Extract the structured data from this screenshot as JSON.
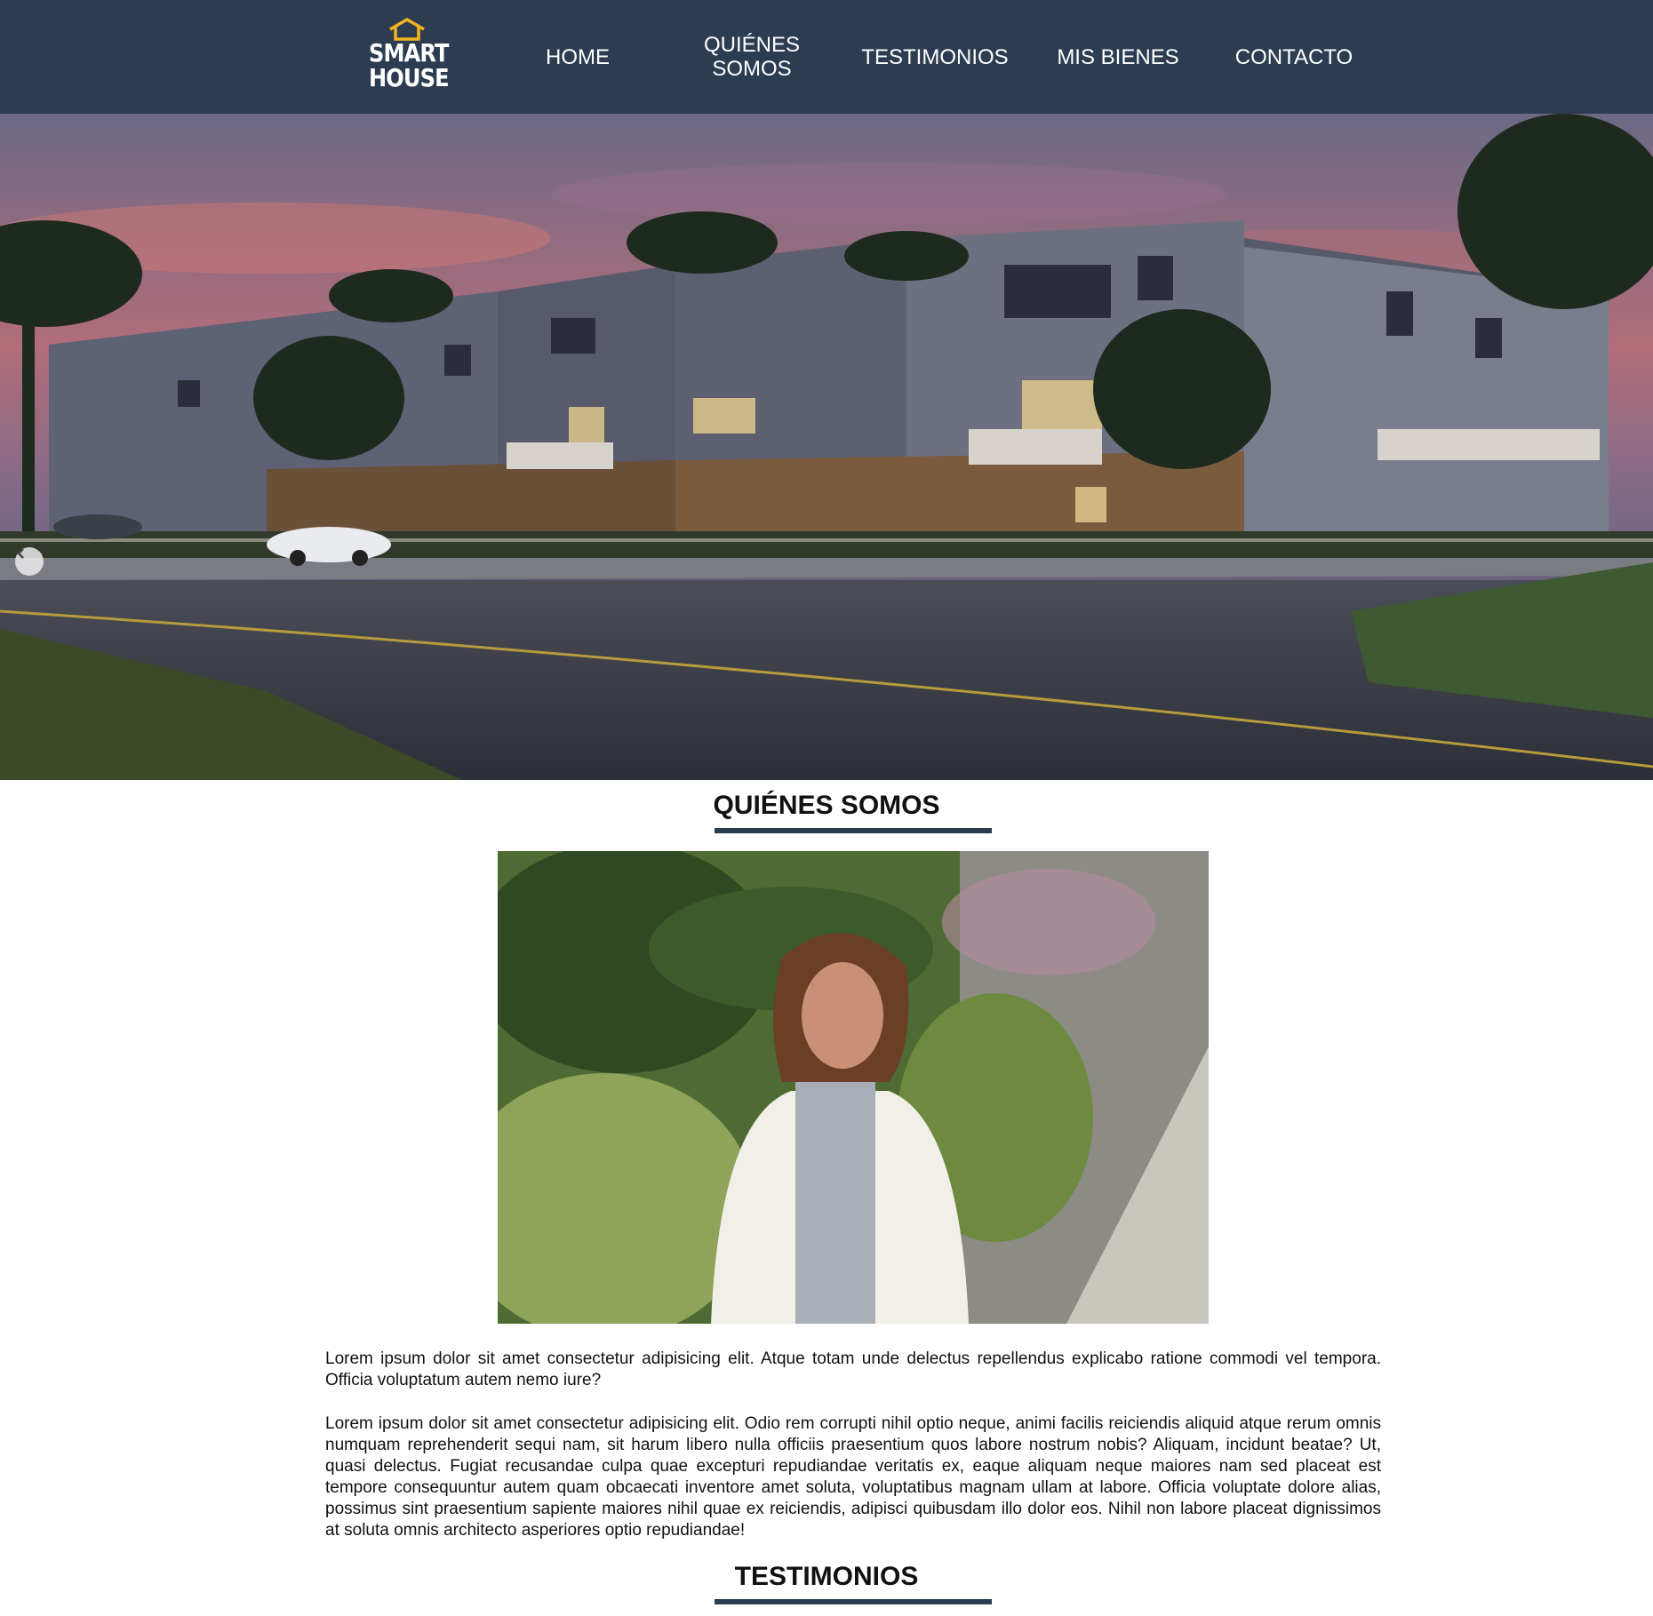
{
  "brand": {
    "line1": "SMART",
    "line2": "HOUSE",
    "accent_color": "#f2b51c"
  },
  "nav": {
    "background": "#2c3d52",
    "items": [
      {
        "label": "HOME"
      },
      {
        "label": "QUIÉNES\nSOMOS"
      },
      {
        "label": "TESTIMONIOS"
      },
      {
        "label": "MIS BIENES"
      },
      {
        "label": "CONTACTO"
      }
    ]
  },
  "hero": {
    "prev_icon": "chevron-left-icon"
  },
  "about": {
    "title": "QUIÉNES SOMOS",
    "paragraphs": [
      "Lorem ipsum dolor sit amet consectetur adipisicing elit. Atque totam unde delectus repellendus explicabo ratione commodi vel tempora. Officia voluptatum autem nemo iure?",
      "Lorem ipsum dolor sit amet consectetur adipisicing elit. Odio rem corrupti nihil optio neque, animi facilis reiciendis aliquid atque rerum omnis numquam reprehenderit sequi nam, sit harum libero nulla officiis praesentium quos labore nostrum nobis? Aliquam, incidunt beatae? Ut, quasi delectus. Fugiat recusandae culpa quae excepturi repudiandae veritatis ex, eaque aliquam neque maiores nam sed placeat est tempore consequuntur autem quam obcaecati inventore amet soluta, voluptatibus magnam ullam at labore. Officia voluptate dolore alias, possimus sint praesentium sapiente maiores nihil quae ex reiciendis, adipisci quibusdam illo dolor eos. Nihil non labore placeat dignissimos at soluta omnis architecto asperiores optio repudiandae!"
    ]
  },
  "testimonials": {
    "title": "TESTIMONIOS"
  }
}
